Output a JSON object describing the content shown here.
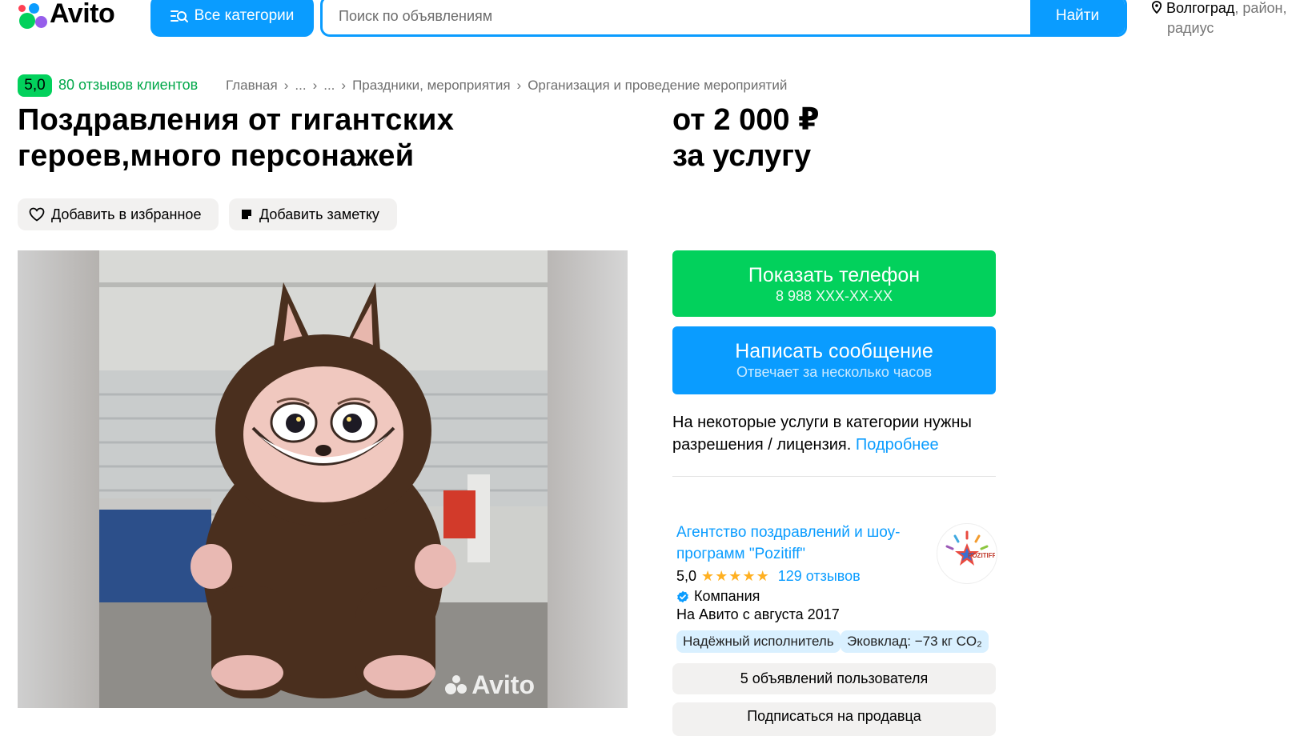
{
  "header": {
    "logo_text": "Avito",
    "categories_label": "Все категории",
    "search_placeholder": "Поиск по объявлениям",
    "search_button": "Найти",
    "location_city": "Волгоград",
    "location_rest": ", район,",
    "location_line2": "радиус"
  },
  "rating": {
    "score": "5,0",
    "reviews_label": "80 отзывов клиентов"
  },
  "breadcrumb": [
    "Главная",
    "...",
    "...",
    "Праздники, мероприятия",
    "Организация и проведение мероприятий"
  ],
  "breadcrumb_sep": "›",
  "listing": {
    "title_line1": "Поздравления от гигантских",
    "title_line2": "героев,много персонажей",
    "price_line1": "от 2 000 ₽",
    "price_line2": "за услугу"
  },
  "actions": {
    "favorite": "Добавить в избранное",
    "note": "Добавить заметку"
  },
  "gallery": {
    "watermark": "Avito"
  },
  "contact": {
    "phone_label": "Показать телефон",
    "phone_number": "8 988 XXX-XX-XX",
    "message_label": "Написать сообщение",
    "message_sub": "Отвечает за несколько часов"
  },
  "notice": {
    "text": "На некоторые услуги в категории нужны разрешения / лицензия.",
    "more": "Подробнее"
  },
  "seller": {
    "name": "Агентство поздравлений и шоу-программ \"Pozitiff\"",
    "avatar_text": "POZITIFF",
    "rating": "5,0",
    "stars": "★★★★★",
    "reviews": "129 отзывов",
    "type": "Компания",
    "since": "На Авито с августа 2017",
    "tags": [
      "Надёжный исполнитель",
      "Эковклад: −73 кг CO₂"
    ],
    "listings_button": "5 объявлений пользователя",
    "subscribe_button": "Подписаться на продавца"
  },
  "colors": {
    "accent_blue": "#0a9cff",
    "accent_green": "#02d15c"
  },
  "icons": [
    "catalog-icon",
    "location-pin-icon",
    "heart-icon",
    "note-icon",
    "verified-icon"
  ]
}
